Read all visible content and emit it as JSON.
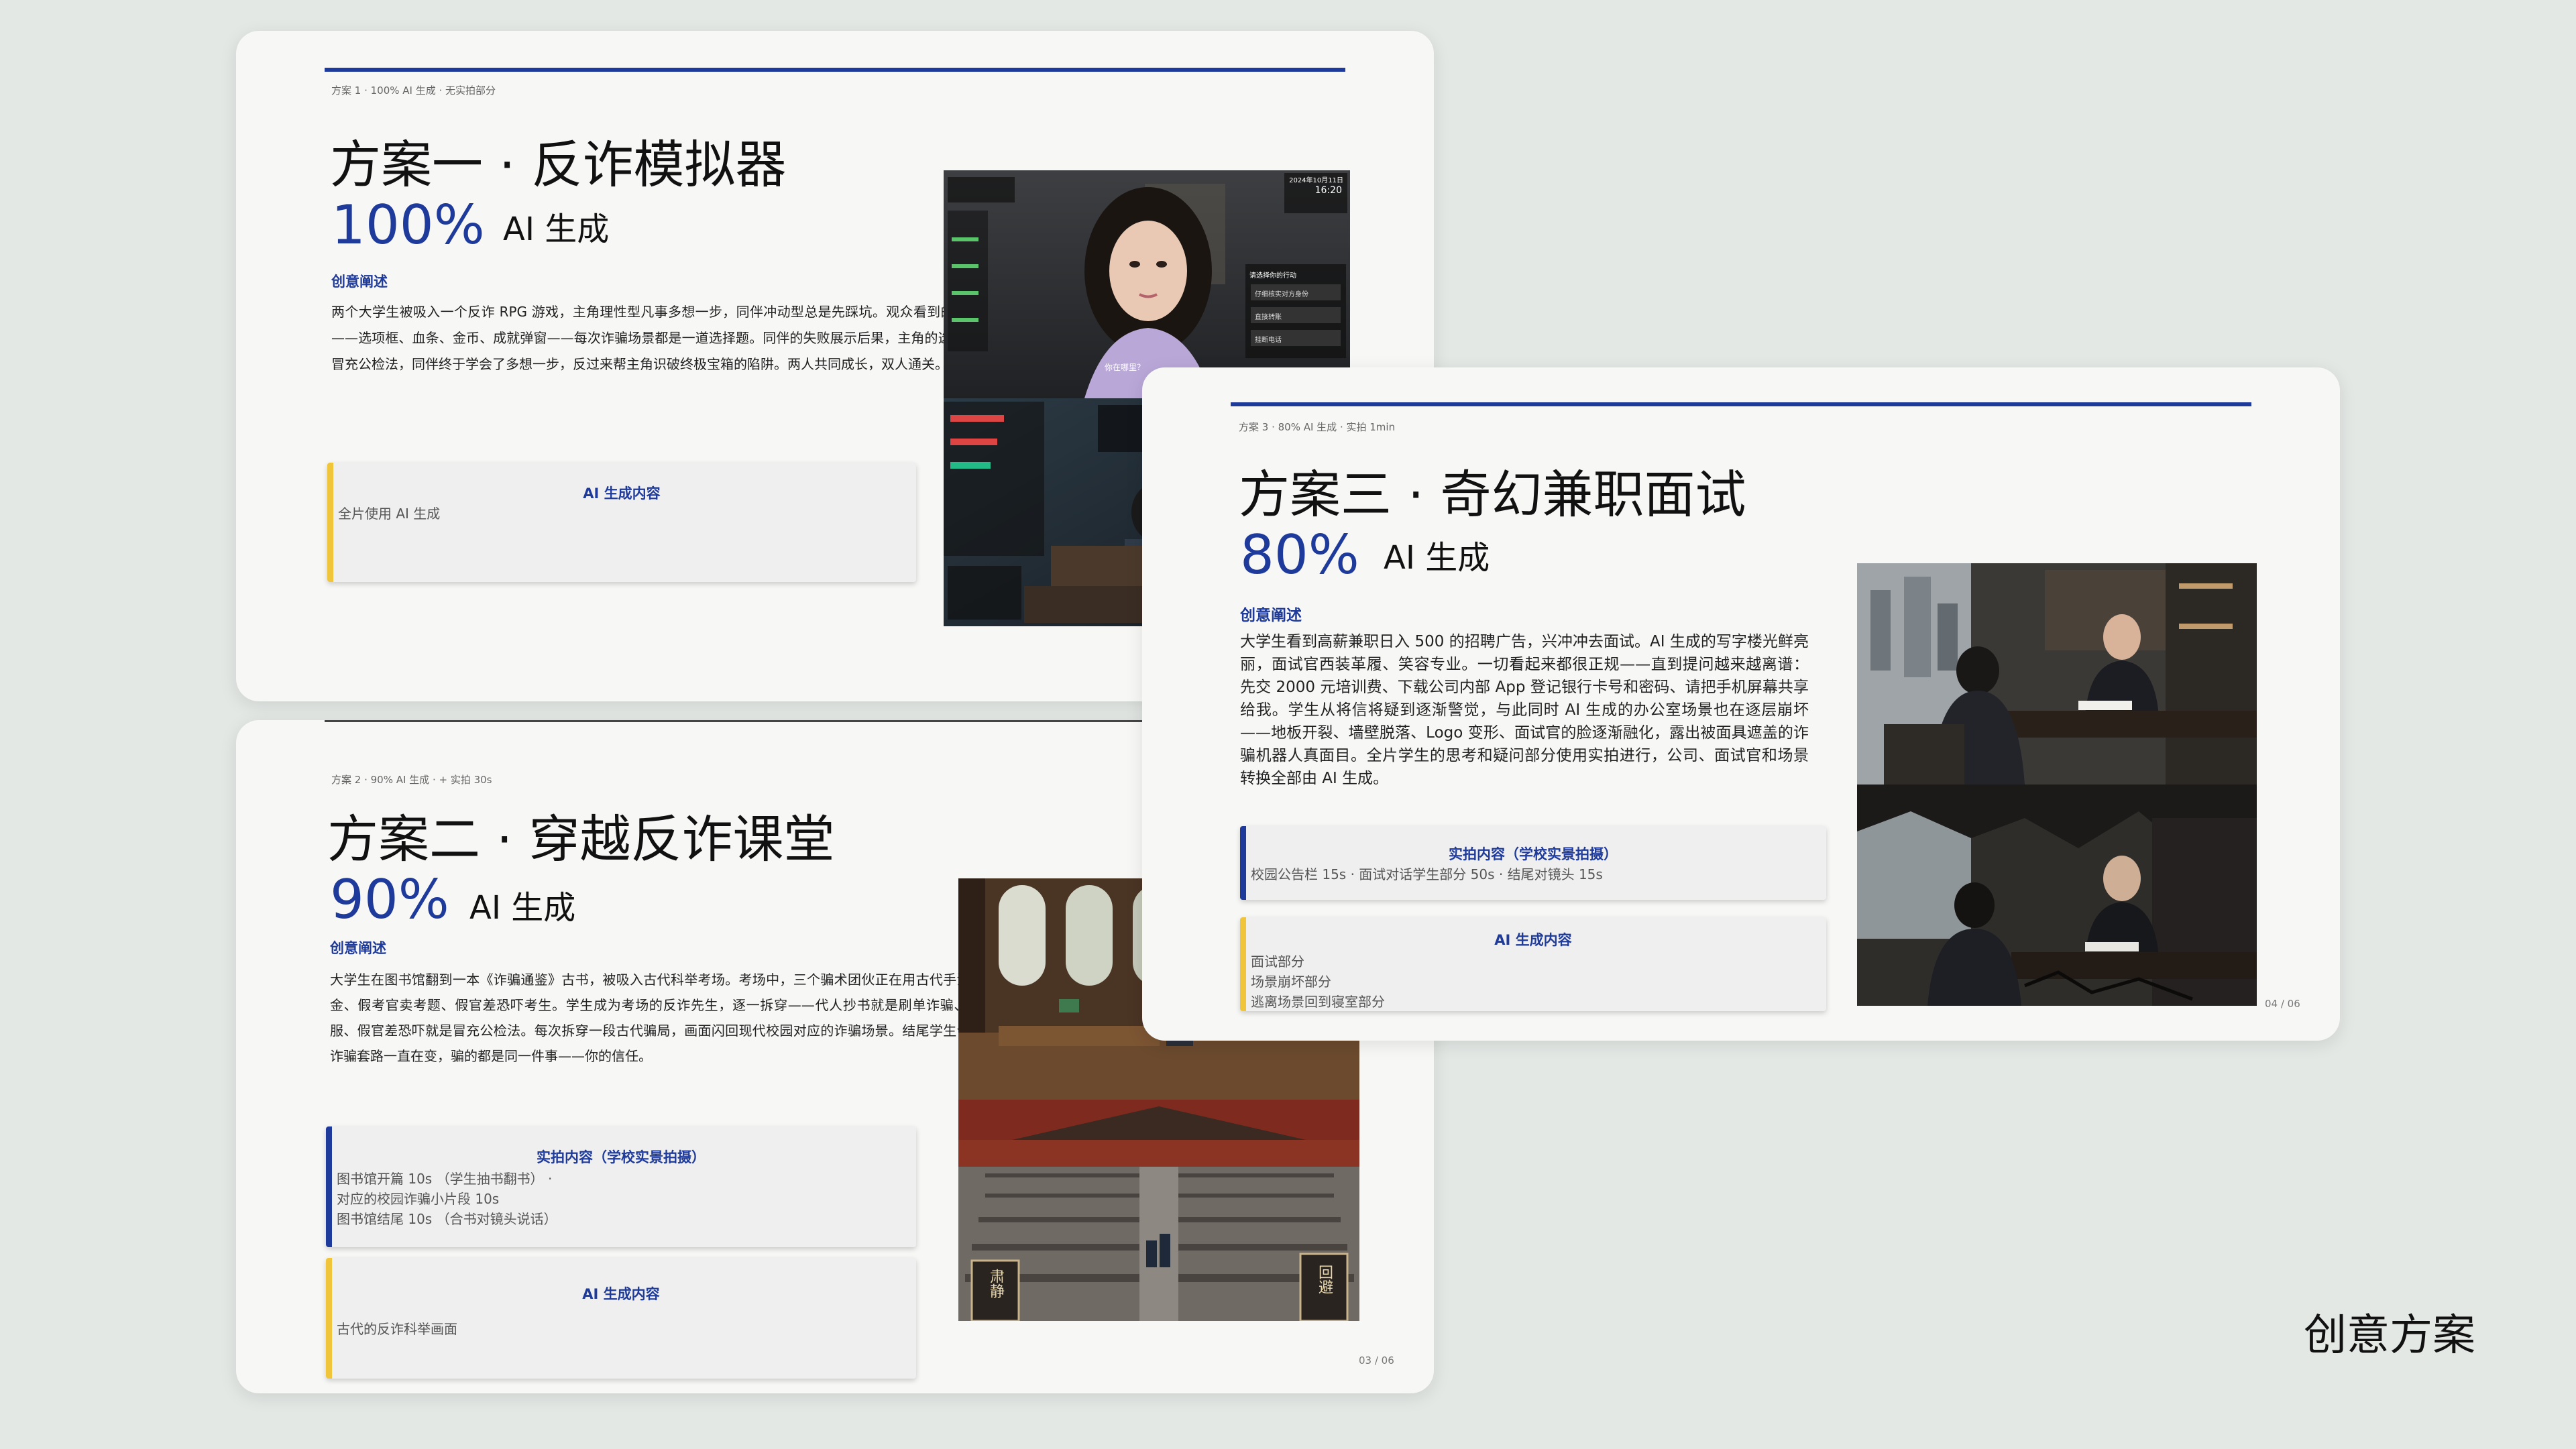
{
  "caption": "创意方案",
  "cards": [
    {
      "id": "plan1",
      "meta": "方案 1 · 100% AI 生成 · 无实拍部分",
      "title": "方案一 · 反诈模拟器",
      "percent": "100%",
      "percent_label": "AI 生成",
      "section_heading": "创意阐述",
      "body": "两个大学生被吸入一个反诈 RPG 游戏，主角理性型凡事多想一步，同伴冲动型总是先踩坑。观众看到的是叠加了游戏 UI 的写实画面——选项框、血条、金币、成就弹窗——每次诈骗场景都是一道选择题。同伴的失败展示后果，主角的选择给出正确答案。到了第三关冒充公检法，同伴终于学会了多想一步，反过来帮主角识破终极宝箱的陷阱。两人共同成长，双人通关。",
      "boxes": [
        {
          "title": "AI 生成内容",
          "lines": [
            "全片使用 AI 生成"
          ],
          "bar": "yellow"
        }
      ],
      "image_alt": "游戏界面叠加写实画面"
    },
    {
      "id": "plan2",
      "meta": "方案 2 · 90% AI 生成 · + 实拍 30s",
      "title": "方案二 · 穿越反诈课堂",
      "percent": "90%",
      "percent_label": "AI 生成",
      "section_heading": "创意阐述",
      "body": "大学生在图书馆翻到一本《诈骗通鉴》古书，被吸入古代科举考场。考场中，三个骗术团伙正在用古代手法欺骗考生：代人抄书骗押金、假考官卖考题、假官差恐吓考生。学生成为考场的反诈先生，逐一拆穿——代人抄书就是刷单诈骗、假考官卖考题就是冒充客服、假官差恐吓就是冒充公检法。每次拆穿一段古代骗局，画面闪回现代校园对应的诈骗场景。结尾学生合上书，对镜头说出核心：诈骗套路一直在变，骗的都是同一件事——你的信任。",
      "boxes": [
        {
          "title": "实拍内容（学校实景拍摄）",
          "lines": [
            "图书馆开篇  10s （学生抽书翻书）  ·",
            "对应的校园诈骗小片段  10s",
            "图书馆结尾  10s （合书对镜头说话）"
          ],
          "bar": "blue"
        },
        {
          "title": "AI 生成内容",
          "lines": [
            "古代的反诈科举画面"
          ],
          "bar": "yellow"
        }
      ],
      "page": "03 / 06"
    },
    {
      "id": "plan3",
      "meta": "方案 3 · 80% AI 生成 · 实拍 1min",
      "title": "方案三 · 奇幻兼职面试",
      "percent": "80%",
      "percent_label": "AI 生成",
      "section_heading": "创意阐述",
      "body": "大学生看到高薪兼职日入 500 的招聘广告，兴冲冲去面试。AI 生成的写字楼光鲜亮丽，面试官西装革履、笑容专业。一切看起来都很正规——直到提问越来越离谱：先交 2000 元培训费、下载公司内部 App 登记银行卡号和密码、请把手机屏幕共享给我。学生从将信将疑到逐渐警觉，与此同时 AI 生成的办公室场景也在逐层崩坏——地板开裂、墙壁脱落、Logo 变形、面试官的脸逐渐融化，露出被面具遮盖的诈骗机器人真面目。全片学生的思考和疑问部分使用实拍进行，公司、面试官和场景转换全部由 AI 生成。",
      "boxes": [
        {
          "title": "实拍内容（学校实景拍摄）",
          "lines": [
            "校园公告栏  15s · 面试对话学生部分  50s · 结尾对镜头  15s"
          ],
          "bar": "blue"
        },
        {
          "title": "AI 生成内容",
          "lines": [
            "面试部分",
            "场景崩坏部分",
            "逃离场景回到寝室部分"
          ],
          "bar": "yellow"
        }
      ],
      "page": "04 / 06"
    }
  ],
  "colors": {
    "accent": "#1e3a9a",
    "box_bar": "#f0c53a",
    "background": "#e4e8e5",
    "card": "#f7f7f5"
  },
  "game_ui": {
    "time_date": "2024年10月11日",
    "time_clock": "16:20",
    "prompt": "请选择你的行动",
    "options": [
      "仔细核实对方身份",
      "直接转账",
      "挂断电话"
    ],
    "subtitle": "你在哪里？"
  },
  "ancient_signs": {
    "left": "肃静",
    "right": "回避"
  }
}
